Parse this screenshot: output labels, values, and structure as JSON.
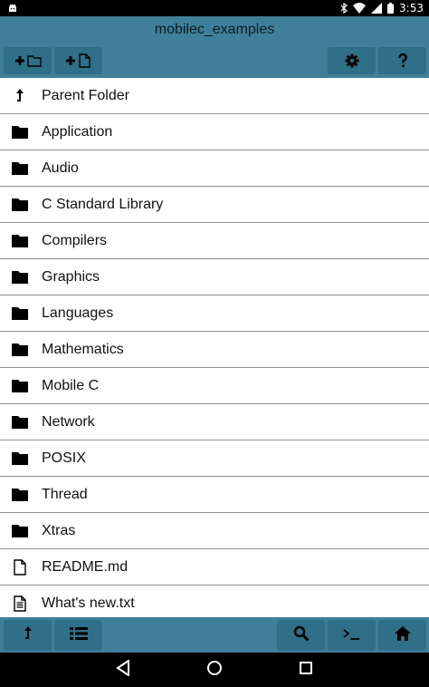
{
  "status_bar": {
    "time": "3:53",
    "icons": [
      "android-icon",
      "bluetooth-icon",
      "wifi-icon",
      "signal-icon",
      "battery-icon"
    ]
  },
  "title": "mobilec_examples",
  "toolbar": {
    "buttons": [
      "new-folder-icon",
      "new-file-icon",
      "settings-icon",
      "help-icon"
    ]
  },
  "files": [
    {
      "name": "Parent Folder",
      "icon": "parent-folder-icon"
    },
    {
      "name": "Application",
      "icon": "folder-icon"
    },
    {
      "name": "Audio",
      "icon": "folder-icon"
    },
    {
      "name": "C Standard Library",
      "icon": "folder-icon"
    },
    {
      "name": "Compilers",
      "icon": "folder-icon"
    },
    {
      "name": "Graphics",
      "icon": "folder-icon"
    },
    {
      "name": "Languages",
      "icon": "folder-icon"
    },
    {
      "name": "Mathematics",
      "icon": "folder-icon"
    },
    {
      "name": "Mobile C",
      "icon": "folder-icon"
    },
    {
      "name": "Network",
      "icon": "folder-icon"
    },
    {
      "name": "POSIX",
      "icon": "folder-icon"
    },
    {
      "name": "Thread",
      "icon": "folder-icon"
    },
    {
      "name": "Xtras",
      "icon": "folder-icon"
    },
    {
      "name": "README.md",
      "icon": "file-icon"
    },
    {
      "name": "What's new.txt",
      "icon": "text-file-icon"
    }
  ],
  "bottom_bar": {
    "buttons": [
      "up-icon",
      "list-view-icon",
      "search-icon",
      "terminal-icon",
      "home-icon"
    ]
  },
  "nav_bar": {
    "buttons": [
      "back-icon",
      "home-circle-icon",
      "recents-icon"
    ]
  },
  "colors": {
    "bar": "#3f7f99",
    "button": "#2f6f88"
  }
}
